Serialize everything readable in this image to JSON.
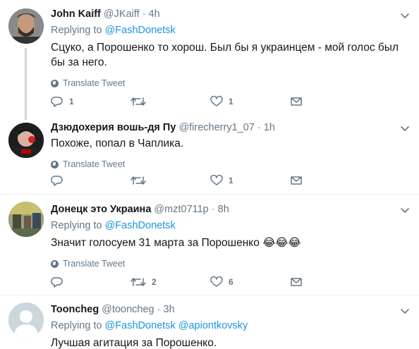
{
  "tweets": [
    {
      "name": "John Kaiff",
      "handle": "@JKaiff",
      "time": "4h",
      "replying_label": "Replying to",
      "mentions": [
        "@FashDonetsk"
      ],
      "text": "Сцуко, а Порошенко то хорош. Был бы я украинцем - мой голос был бы за него.",
      "translate": "Translate Tweet",
      "replies": "1",
      "retweets": "",
      "likes": "1"
    },
    {
      "name": "Дзюдохерия вошь-дя Пу",
      "handle": "@firecherry1_07",
      "time": "1h",
      "text": "Похоже, попал в Чаплика.",
      "translate": "Translate Tweet",
      "replies": "",
      "retweets": "",
      "likes": "1"
    },
    {
      "name": "Донецк это Украина",
      "handle": "@mzt0711p",
      "time": "8h",
      "replying_label": "Replying to",
      "mentions": [
        "@FashDonetsk"
      ],
      "text": "Значит голосуем 31 марта за Порошенко",
      "emoji": "😂😂😂",
      "translate": "Translate Tweet",
      "replies": "",
      "retweets": "2",
      "likes": "6"
    },
    {
      "name": "Tooncheg",
      "handle": "@tooncheg",
      "time": "3h",
      "replying_label": "Replying to",
      "mentions": [
        "@FashDonetsk",
        "@apiontkovsky"
      ],
      "text": "Лучшая агитация за Порошенко."
    }
  ],
  "separator": "·",
  "colors": {
    "accent": "#1b95e0",
    "muted": "#657786",
    "divider": "#e6ecf0"
  },
  "icons": [
    "reply-icon",
    "retweet-icon",
    "like-icon",
    "share-icon",
    "chevron-down-icon",
    "globe-icon"
  ]
}
